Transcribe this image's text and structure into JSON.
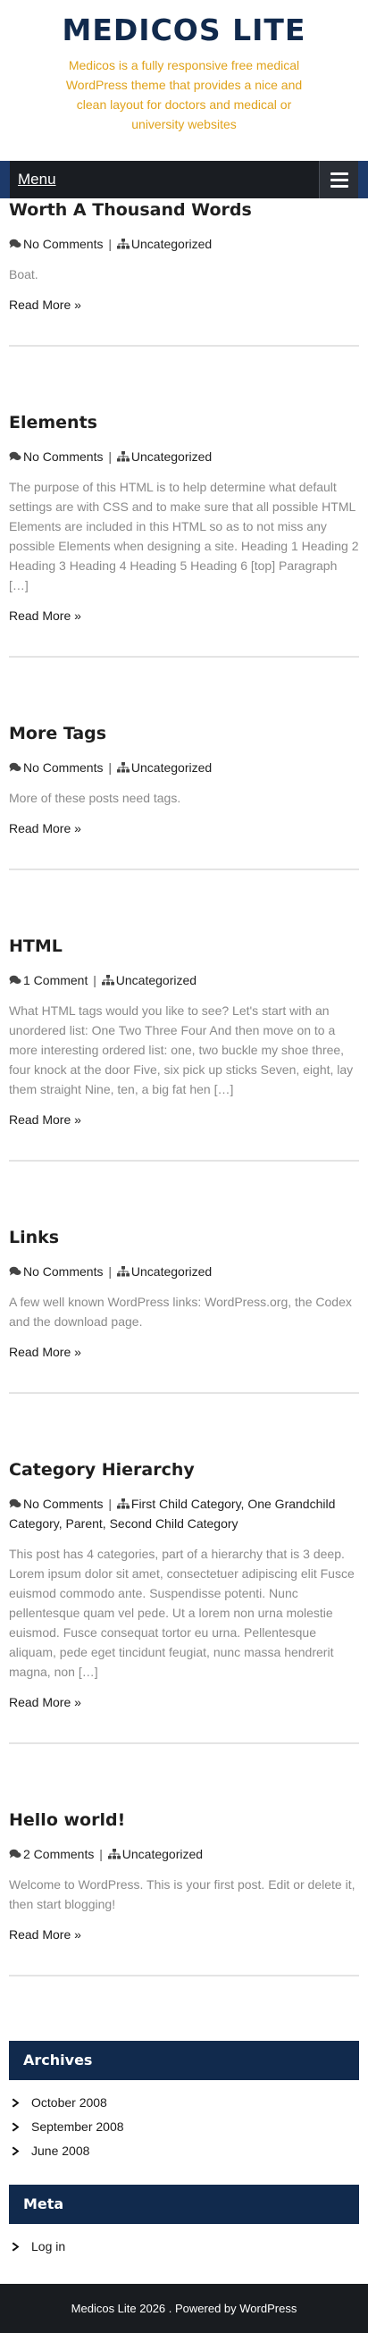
{
  "site": {
    "title": "MEDICOS LITE",
    "description": "Medicos is a fully responsive free medical WordPress theme that provides a nice and clean layout for doctors and medical or university websites"
  },
  "nav": {
    "menu_label": "Menu"
  },
  "read_more_label": "Read More »",
  "posts": [
    {
      "title": "Worth A Thousand Words",
      "comments": "No Comments",
      "categories": "Uncategorized",
      "excerpt": "Boat."
    },
    {
      "title": "Elements",
      "comments": "No Comments",
      "categories": "Uncategorized",
      "excerpt": "The purpose of this HTML is to help determine what default settings are with CSS and to make sure that all possible HTML Elements are included in this HTML so as to not miss any possible Elements when designing a site. Heading 1 Heading 2 Heading 3 Heading 4 Heading 5 Heading 6 [top] Paragraph […]"
    },
    {
      "title": "More Tags",
      "comments": "No Comments",
      "categories": "Uncategorized",
      "excerpt": "More of these posts need tags."
    },
    {
      "title": "HTML",
      "comments": "1 Comment",
      "categories": "Uncategorized",
      "excerpt": "What HTML tags would you like to see? Let's start with an unordered list: One Two Three Four And then move on to a more interesting ordered list: one, two buckle my shoe three, four knock at the door Five, six pick up sticks Seven, eight, lay them straight Nine, ten, a big fat hen […]"
    },
    {
      "title": "Links",
      "comments": "No Comments",
      "categories": "Uncategorized",
      "excerpt": "A few well known WordPress links: WordPress.org, the Codex and the download page."
    },
    {
      "title": "Category Hierarchy",
      "comments": "No Comments",
      "categories": "First Child Category, One Grandchild Category, Parent, Second Child Category",
      "excerpt": "This post has 4 categories, part of a hierarchy that is 3 deep. Lorem ipsum dolor sit amet, consectetuer adipiscing elit Fusce euismod commodo ante. Suspendisse potenti. Nunc pellentesque quam vel pede. Ut a lorem non urna molestie euismod. Fusce consequat tortor eu urna. Pellentesque aliquam, pede eget tincidunt feugiat, nunc massa hendrerit magna, non […]"
    },
    {
      "title": "Hello world!",
      "comments": "2 Comments",
      "categories": "Uncategorized",
      "excerpt": "Welcome to WordPress. This is your first post. Edit or delete it, then start blogging!"
    }
  ],
  "archives": {
    "title": "Archives",
    "items": [
      "October 2008",
      "September 2008",
      "June 2008"
    ]
  },
  "meta": {
    "title": "Meta",
    "items": [
      "Log in"
    ]
  },
  "footer": {
    "text": "Medicos Lite 2026 . Powered by WordPress"
  },
  "colors": {
    "navy": "#112a4d",
    "gold": "#e0a21a",
    "dark": "#1a1d22"
  },
  "icons": {
    "comments": "comments-icon",
    "category": "sitemap-icon",
    "list": "chevron-right-icon",
    "menu": "hamburger-icon"
  }
}
